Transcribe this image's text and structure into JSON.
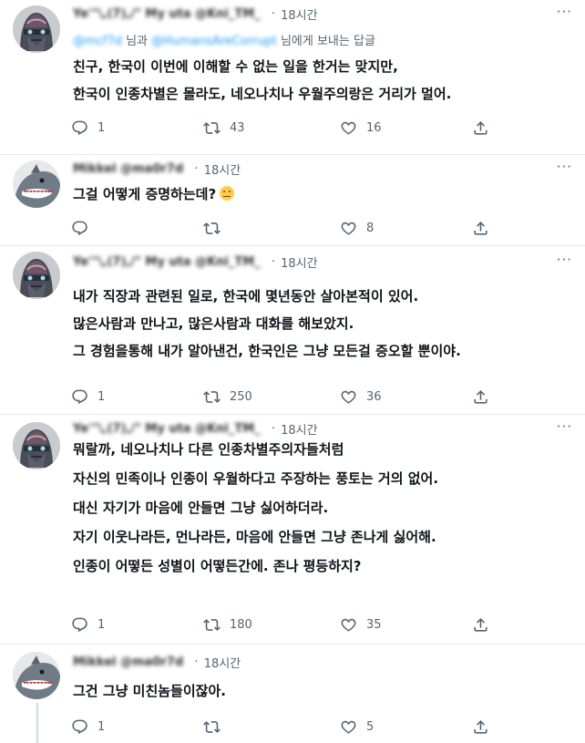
{
  "tweets": [
    {
      "author_blurred": "Ye'\"\\,(7),/\" My uta @Kni_TM_",
      "dot": "·",
      "time": "18시간",
      "more": "···",
      "avatar_icon": "robot-mask-icon",
      "replying_mention1": "@mcf7d",
      "replying_mid": "님과",
      "replying_mention2": "@HumansAreCorrupt",
      "replying_suffix": "님에게 보내는 답글",
      "lines": [
        "친구, 한국이 이번에 이해할 수 없는 일을 한거는 맞지만,",
        "한국이 인종차별은 몰라도, 네오나치나 우월주의랑은 거리가 멀어."
      ],
      "reply_count": "1",
      "retweet_count": "43",
      "like_count": "16"
    },
    {
      "author_blurred": "Mikkel @ma0r7d",
      "dot": "·",
      "time": "18시간",
      "more": "···",
      "avatar_icon": "shark-avatar-icon",
      "lines": [
        "그걸 어떻게 증명하는데?"
      ],
      "emoji": "pouting-face-emoji",
      "reply_count": "",
      "retweet_count": "",
      "like_count": "8"
    },
    {
      "author_blurred": "Ye'\"\\,(7),/\" My uta @Kni_TM_",
      "dot": "·",
      "time": "18시간",
      "more": "···",
      "avatar_icon": "robot-mask-icon",
      "lines": [
        "내가 직장과 관련된 일로, 한국에 몇년동안 살아본적이 있어.",
        "많은사람과 만나고, 많은사람과 대화를 해보았지.",
        "그 경험을통해 내가 알아낸건, 한국인은 그냥 모든걸 증오할 뿐이야."
      ],
      "reply_count": "1",
      "retweet_count": "250",
      "like_count": "36"
    },
    {
      "author_blurred": "Ye'\"\\,(7),/\" My uta @Kni_TM_",
      "dot": "·",
      "time": "18시간",
      "more": "···",
      "avatar_icon": "robot-mask-icon",
      "lines": [
        "뭐랄까, 네오나치나 다른 인종차별주의자들처럼",
        "자신의 민족이나 인종이 우월하다고 주장하는 풍토는 거의 없어.",
        "대신 자기가 마음에 안들면 그냥 싫어하더라.",
        "자기 이웃나라든, 먼나라든, 마음에 안들면 그냥 존나게 싫어해.",
        "인종이 어떻든 성별이 어떻든간에. 존나 평등하지?"
      ],
      "reply_count": "1",
      "retweet_count": "180",
      "like_count": "35"
    },
    {
      "author_blurred": "Mikkel @ma0r7d",
      "dot": "·",
      "time": "18시간",
      "more": "···",
      "avatar_icon": "shark-avatar-icon",
      "lines": [
        "그건 그냥 미친놈들이잖아."
      ],
      "reply_count": "1",
      "retweet_count": "",
      "like_count": "5"
    }
  ]
}
